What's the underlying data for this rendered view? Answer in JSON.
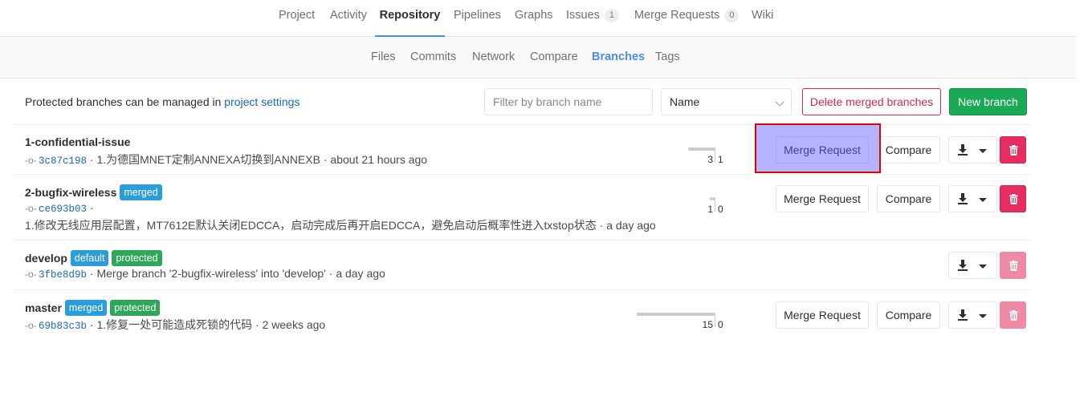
{
  "top_nav": {
    "items": [
      {
        "label": "Project"
      },
      {
        "label": "Activity"
      },
      {
        "label": "Repository"
      },
      {
        "label": "Pipelines"
      },
      {
        "label": "Graphs"
      },
      {
        "label": "Issues",
        "count": "1"
      },
      {
        "label": "Merge Requests",
        "count": "0"
      },
      {
        "label": "Wiki"
      }
    ],
    "active": "Repository"
  },
  "sub_nav": {
    "items": [
      {
        "label": "Files"
      },
      {
        "label": "Commits"
      },
      {
        "label": "Network"
      },
      {
        "label": "Compare"
      },
      {
        "label": "Branches"
      },
      {
        "label": "Tags"
      }
    ],
    "active": "Branches"
  },
  "toolbar": {
    "protected_text": "Protected branches can be managed in",
    "protected_link": "project settings",
    "filter_placeholder": "Filter by branch name",
    "sort_value": "Name",
    "delete_merged_label": "Delete merged branches",
    "new_branch_label": "New branch"
  },
  "branches": [
    {
      "name": "1-confidential-issue",
      "labels": [],
      "sha": "3c87c198",
      "message": "1.为德国MNET定制ANNEXA切换到ANNEXB",
      "time": "about 21 hours ago",
      "behind": "3",
      "ahead": "1",
      "merge_request_label": "Merge Request",
      "compare_label": "Compare",
      "delete_enabled": true
    },
    {
      "name": "2-bugfix-wireless",
      "labels": [
        "merged"
      ],
      "sha": "ce693b03",
      "message": "1.修改无线应用层配置，MT7612E默认关闭EDCCA，启动完成后再开启EDCCA，避免启动后概率性进入txstop状态",
      "time": "a day ago",
      "behind": "1",
      "ahead": "0",
      "merge_request_label": "Merge Request",
      "compare_label": "Compare",
      "delete_enabled": true
    },
    {
      "name": "develop",
      "labels": [
        "default",
        "protected"
      ],
      "sha": "3fbe8d9b",
      "message": "Merge branch '2-bugfix-wireless' into 'develop'",
      "time": "a day ago",
      "delete_enabled": false
    },
    {
      "name": "master",
      "labels": [
        "merged",
        "protected"
      ],
      "sha": "69b83c3b",
      "message": "1.修复一处可能造成死锁的代码",
      "time": "2 weeks ago",
      "behind": "15",
      "ahead": "0",
      "merge_request_label": "Merge Request",
      "compare_label": "Compare",
      "delete_enabled": false
    }
  ],
  "colors": {
    "accent": "#4a8bee",
    "link": "#1b69b6",
    "label_blue": "#2c9ddb",
    "label_green": "#2fa65a",
    "new_branch": "#1aaa55",
    "danger": "#e52d5f",
    "danger_disabled": "#ee8aa6",
    "highlight_border": "#e00000"
  }
}
